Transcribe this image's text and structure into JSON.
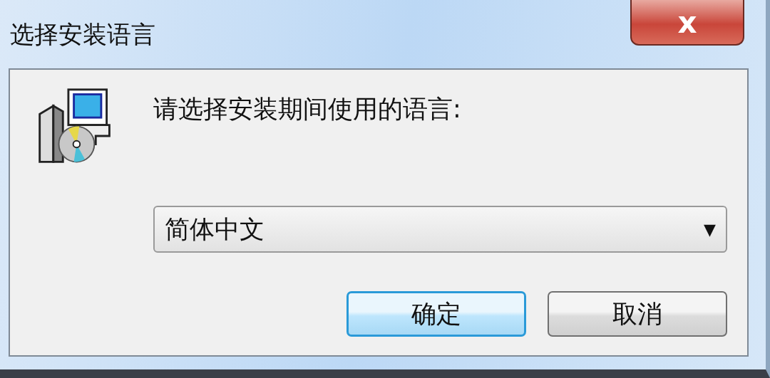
{
  "window": {
    "title": "选择安装语言",
    "close_label": "x"
  },
  "prompt": "请选择安装期间使用的语言:",
  "language_select": {
    "value": "简体中文",
    "arrow": "▼"
  },
  "buttons": [
    {
      "label": "确定",
      "default": true
    },
    {
      "label": "取消",
      "default": false
    }
  ]
}
